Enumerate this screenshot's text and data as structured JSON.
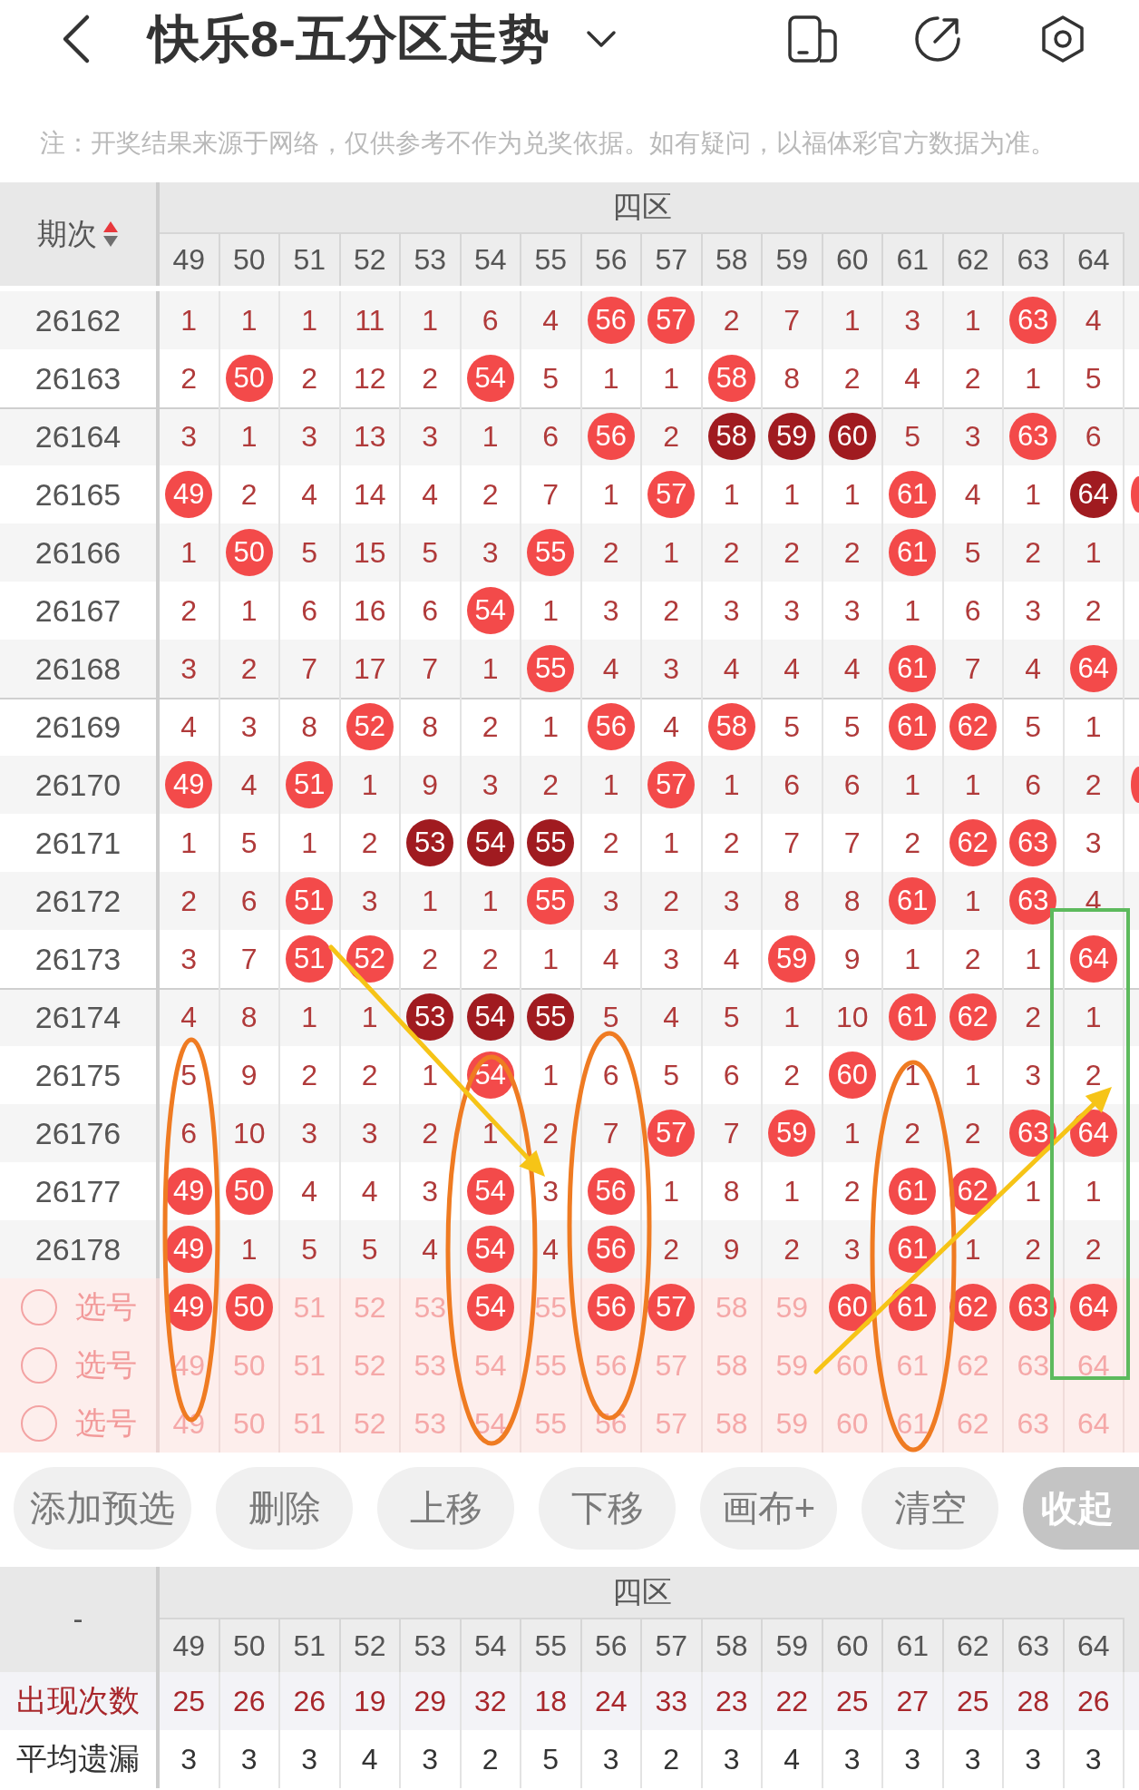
{
  "header": {
    "title": "快乐8-五分区走势"
  },
  "note": "注：开奖结果来源于网络，仅供参考不作为兑奖依据。如有疑问，以福体彩官方数据为准。",
  "trend_table": {
    "period_header": "期次",
    "sort_ascending": true,
    "group": "四区",
    "columns": [
      "49",
      "50",
      "51",
      "52",
      "53",
      "54",
      "55",
      "56",
      "57",
      "58",
      "59",
      "60",
      "61",
      "62",
      "63",
      "64"
    ],
    "rows": [
      {
        "period": "26162",
        "edge_ball": false,
        "cells": [
          {
            "text": "1",
            "kind": "miss"
          },
          {
            "text": "1",
            "kind": "miss"
          },
          {
            "text": "1",
            "kind": "miss"
          },
          {
            "text": "11",
            "kind": "miss"
          },
          {
            "text": "1",
            "kind": "miss"
          },
          {
            "text": "6",
            "kind": "miss"
          },
          {
            "text": "4",
            "kind": "miss"
          },
          {
            "text": "56",
            "kind": "hit"
          },
          {
            "text": "57",
            "kind": "hit"
          },
          {
            "text": "2",
            "kind": "miss"
          },
          {
            "text": "7",
            "kind": "miss"
          },
          {
            "text": "1",
            "kind": "miss"
          },
          {
            "text": "3",
            "kind": "miss"
          },
          {
            "text": "1",
            "kind": "miss"
          },
          {
            "text": "63",
            "kind": "hit"
          },
          {
            "text": "4",
            "kind": "miss"
          }
        ]
      },
      {
        "period": "26163",
        "edge_ball": false,
        "cells": [
          {
            "text": "2",
            "kind": "miss"
          },
          {
            "text": "50",
            "kind": "hit"
          },
          {
            "text": "2",
            "kind": "miss"
          },
          {
            "text": "12",
            "kind": "miss"
          },
          {
            "text": "2",
            "kind": "miss"
          },
          {
            "text": "54",
            "kind": "hit"
          },
          {
            "text": "5",
            "kind": "miss"
          },
          {
            "text": "1",
            "kind": "miss"
          },
          {
            "text": "1",
            "kind": "miss"
          },
          {
            "text": "58",
            "kind": "hit"
          },
          {
            "text": "8",
            "kind": "miss"
          },
          {
            "text": "2",
            "kind": "miss"
          },
          {
            "text": "4",
            "kind": "miss"
          },
          {
            "text": "2",
            "kind": "miss"
          },
          {
            "text": "1",
            "kind": "miss"
          },
          {
            "text": "5",
            "kind": "miss"
          }
        ]
      },
      {
        "period": "26164",
        "edge_ball": false,
        "cells": [
          {
            "text": "3",
            "kind": "miss"
          },
          {
            "text": "1",
            "kind": "miss"
          },
          {
            "text": "3",
            "kind": "miss"
          },
          {
            "text": "13",
            "kind": "miss"
          },
          {
            "text": "3",
            "kind": "miss"
          },
          {
            "text": "1",
            "kind": "miss"
          },
          {
            "text": "6",
            "kind": "miss"
          },
          {
            "text": "56",
            "kind": "hit"
          },
          {
            "text": "2",
            "kind": "miss"
          },
          {
            "text": "58",
            "kind": "streak"
          },
          {
            "text": "59",
            "kind": "streak"
          },
          {
            "text": "60",
            "kind": "streak"
          },
          {
            "text": "5",
            "kind": "miss"
          },
          {
            "text": "3",
            "kind": "miss"
          },
          {
            "text": "63",
            "kind": "hit"
          },
          {
            "text": "6",
            "kind": "miss"
          }
        ]
      },
      {
        "period": "26165",
        "edge_ball": true,
        "cells": [
          {
            "text": "49",
            "kind": "hit"
          },
          {
            "text": "2",
            "kind": "miss"
          },
          {
            "text": "4",
            "kind": "miss"
          },
          {
            "text": "14",
            "kind": "miss"
          },
          {
            "text": "4",
            "kind": "miss"
          },
          {
            "text": "2",
            "kind": "miss"
          },
          {
            "text": "7",
            "kind": "miss"
          },
          {
            "text": "1",
            "kind": "miss"
          },
          {
            "text": "57",
            "kind": "hit"
          },
          {
            "text": "1",
            "kind": "miss"
          },
          {
            "text": "1",
            "kind": "miss"
          },
          {
            "text": "1",
            "kind": "miss"
          },
          {
            "text": "61",
            "kind": "hit"
          },
          {
            "text": "4",
            "kind": "miss"
          },
          {
            "text": "1",
            "kind": "miss"
          },
          {
            "text": "64",
            "kind": "streak"
          }
        ]
      },
      {
        "period": "26166",
        "edge_ball": false,
        "cells": [
          {
            "text": "1",
            "kind": "miss"
          },
          {
            "text": "50",
            "kind": "hit"
          },
          {
            "text": "5",
            "kind": "miss"
          },
          {
            "text": "15",
            "kind": "miss"
          },
          {
            "text": "5",
            "kind": "miss"
          },
          {
            "text": "3",
            "kind": "miss"
          },
          {
            "text": "55",
            "kind": "hit"
          },
          {
            "text": "2",
            "kind": "miss"
          },
          {
            "text": "1",
            "kind": "miss"
          },
          {
            "text": "2",
            "kind": "miss"
          },
          {
            "text": "2",
            "kind": "miss"
          },
          {
            "text": "2",
            "kind": "miss"
          },
          {
            "text": "61",
            "kind": "hit"
          },
          {
            "text": "5",
            "kind": "miss"
          },
          {
            "text": "2",
            "kind": "miss"
          },
          {
            "text": "1",
            "kind": "miss"
          }
        ]
      },
      {
        "period": "26167",
        "edge_ball": false,
        "cells": [
          {
            "text": "2",
            "kind": "miss"
          },
          {
            "text": "1",
            "kind": "miss"
          },
          {
            "text": "6",
            "kind": "miss"
          },
          {
            "text": "16",
            "kind": "miss"
          },
          {
            "text": "6",
            "kind": "miss"
          },
          {
            "text": "54",
            "kind": "hit"
          },
          {
            "text": "1",
            "kind": "miss"
          },
          {
            "text": "3",
            "kind": "miss"
          },
          {
            "text": "2",
            "kind": "miss"
          },
          {
            "text": "3",
            "kind": "miss"
          },
          {
            "text": "3",
            "kind": "miss"
          },
          {
            "text": "3",
            "kind": "miss"
          },
          {
            "text": "1",
            "kind": "miss"
          },
          {
            "text": "6",
            "kind": "miss"
          },
          {
            "text": "3",
            "kind": "miss"
          },
          {
            "text": "2",
            "kind": "miss"
          }
        ]
      },
      {
        "period": "26168",
        "edge_ball": false,
        "cells": [
          {
            "text": "3",
            "kind": "miss"
          },
          {
            "text": "2",
            "kind": "miss"
          },
          {
            "text": "7",
            "kind": "miss"
          },
          {
            "text": "17",
            "kind": "miss"
          },
          {
            "text": "7",
            "kind": "miss"
          },
          {
            "text": "1",
            "kind": "miss"
          },
          {
            "text": "55",
            "kind": "hit"
          },
          {
            "text": "4",
            "kind": "miss"
          },
          {
            "text": "3",
            "kind": "miss"
          },
          {
            "text": "4",
            "kind": "miss"
          },
          {
            "text": "4",
            "kind": "miss"
          },
          {
            "text": "4",
            "kind": "miss"
          },
          {
            "text": "61",
            "kind": "hit"
          },
          {
            "text": "7",
            "kind": "miss"
          },
          {
            "text": "4",
            "kind": "miss"
          },
          {
            "text": "64",
            "kind": "hit"
          }
        ]
      },
      {
        "period": "26169",
        "edge_ball": false,
        "cells": [
          {
            "text": "4",
            "kind": "miss"
          },
          {
            "text": "3",
            "kind": "miss"
          },
          {
            "text": "8",
            "kind": "miss"
          },
          {
            "text": "52",
            "kind": "hit"
          },
          {
            "text": "8",
            "kind": "miss"
          },
          {
            "text": "2",
            "kind": "miss"
          },
          {
            "text": "1",
            "kind": "miss"
          },
          {
            "text": "56",
            "kind": "hit"
          },
          {
            "text": "4",
            "kind": "miss"
          },
          {
            "text": "58",
            "kind": "hit"
          },
          {
            "text": "5",
            "kind": "miss"
          },
          {
            "text": "5",
            "kind": "miss"
          },
          {
            "text": "61",
            "kind": "hit"
          },
          {
            "text": "62",
            "kind": "hit"
          },
          {
            "text": "5",
            "kind": "miss"
          },
          {
            "text": "1",
            "kind": "miss"
          }
        ]
      },
      {
        "period": "26170",
        "edge_ball": true,
        "cells": [
          {
            "text": "49",
            "kind": "hit"
          },
          {
            "text": "4",
            "kind": "miss"
          },
          {
            "text": "51",
            "kind": "hit"
          },
          {
            "text": "1",
            "kind": "miss"
          },
          {
            "text": "9",
            "kind": "miss"
          },
          {
            "text": "3",
            "kind": "miss"
          },
          {
            "text": "2",
            "kind": "miss"
          },
          {
            "text": "1",
            "kind": "miss"
          },
          {
            "text": "57",
            "kind": "hit"
          },
          {
            "text": "1",
            "kind": "miss"
          },
          {
            "text": "6",
            "kind": "miss"
          },
          {
            "text": "6",
            "kind": "miss"
          },
          {
            "text": "1",
            "kind": "miss"
          },
          {
            "text": "1",
            "kind": "miss"
          },
          {
            "text": "6",
            "kind": "miss"
          },
          {
            "text": "2",
            "kind": "miss"
          }
        ]
      },
      {
        "period": "26171",
        "edge_ball": false,
        "cells": [
          {
            "text": "1",
            "kind": "miss"
          },
          {
            "text": "5",
            "kind": "miss"
          },
          {
            "text": "1",
            "kind": "miss"
          },
          {
            "text": "2",
            "kind": "miss"
          },
          {
            "text": "53",
            "kind": "streak"
          },
          {
            "text": "54",
            "kind": "streak"
          },
          {
            "text": "55",
            "kind": "streak"
          },
          {
            "text": "2",
            "kind": "miss"
          },
          {
            "text": "1",
            "kind": "miss"
          },
          {
            "text": "2",
            "kind": "miss"
          },
          {
            "text": "7",
            "kind": "miss"
          },
          {
            "text": "7",
            "kind": "miss"
          },
          {
            "text": "2",
            "kind": "miss"
          },
          {
            "text": "62",
            "kind": "hit"
          },
          {
            "text": "63",
            "kind": "hit"
          },
          {
            "text": "3",
            "kind": "miss"
          }
        ]
      },
      {
        "period": "26172",
        "edge_ball": false,
        "cells": [
          {
            "text": "2",
            "kind": "miss"
          },
          {
            "text": "6",
            "kind": "miss"
          },
          {
            "text": "51",
            "kind": "hit"
          },
          {
            "text": "3",
            "kind": "miss"
          },
          {
            "text": "1",
            "kind": "miss"
          },
          {
            "text": "1",
            "kind": "miss"
          },
          {
            "text": "55",
            "kind": "hit"
          },
          {
            "text": "3",
            "kind": "miss"
          },
          {
            "text": "2",
            "kind": "miss"
          },
          {
            "text": "3",
            "kind": "miss"
          },
          {
            "text": "8",
            "kind": "miss"
          },
          {
            "text": "8",
            "kind": "miss"
          },
          {
            "text": "61",
            "kind": "hit"
          },
          {
            "text": "1",
            "kind": "miss"
          },
          {
            "text": "63",
            "kind": "hit"
          },
          {
            "text": "4",
            "kind": "miss"
          }
        ]
      },
      {
        "period": "26173",
        "edge_ball": false,
        "cells": [
          {
            "text": "3",
            "kind": "miss"
          },
          {
            "text": "7",
            "kind": "miss"
          },
          {
            "text": "51",
            "kind": "hit"
          },
          {
            "text": "52",
            "kind": "hit"
          },
          {
            "text": "2",
            "kind": "miss"
          },
          {
            "text": "2",
            "kind": "miss"
          },
          {
            "text": "1",
            "kind": "miss"
          },
          {
            "text": "4",
            "kind": "miss"
          },
          {
            "text": "3",
            "kind": "miss"
          },
          {
            "text": "4",
            "kind": "miss"
          },
          {
            "text": "59",
            "kind": "hit"
          },
          {
            "text": "9",
            "kind": "miss"
          },
          {
            "text": "1",
            "kind": "miss"
          },
          {
            "text": "2",
            "kind": "miss"
          },
          {
            "text": "1",
            "kind": "miss"
          },
          {
            "text": "64",
            "kind": "hit"
          }
        ]
      },
      {
        "period": "26174",
        "edge_ball": false,
        "cells": [
          {
            "text": "4",
            "kind": "miss"
          },
          {
            "text": "8",
            "kind": "miss"
          },
          {
            "text": "1",
            "kind": "miss"
          },
          {
            "text": "1",
            "kind": "miss"
          },
          {
            "text": "53",
            "kind": "streak"
          },
          {
            "text": "54",
            "kind": "streak"
          },
          {
            "text": "55",
            "kind": "streak"
          },
          {
            "text": "5",
            "kind": "miss"
          },
          {
            "text": "4",
            "kind": "miss"
          },
          {
            "text": "5",
            "kind": "miss"
          },
          {
            "text": "1",
            "kind": "miss"
          },
          {
            "text": "10",
            "kind": "miss"
          },
          {
            "text": "61",
            "kind": "hit"
          },
          {
            "text": "62",
            "kind": "hit"
          },
          {
            "text": "2",
            "kind": "miss"
          },
          {
            "text": "1",
            "kind": "miss"
          }
        ]
      },
      {
        "period": "26175",
        "edge_ball": false,
        "cells": [
          {
            "text": "5",
            "kind": "miss"
          },
          {
            "text": "9",
            "kind": "miss"
          },
          {
            "text": "2",
            "kind": "miss"
          },
          {
            "text": "2",
            "kind": "miss"
          },
          {
            "text": "1",
            "kind": "miss"
          },
          {
            "text": "54",
            "kind": "hit"
          },
          {
            "text": "1",
            "kind": "miss"
          },
          {
            "text": "6",
            "kind": "miss"
          },
          {
            "text": "5",
            "kind": "miss"
          },
          {
            "text": "6",
            "kind": "miss"
          },
          {
            "text": "2",
            "kind": "miss"
          },
          {
            "text": "60",
            "kind": "hit"
          },
          {
            "text": "1",
            "kind": "miss"
          },
          {
            "text": "1",
            "kind": "miss"
          },
          {
            "text": "3",
            "kind": "miss"
          },
          {
            "text": "2",
            "kind": "miss"
          }
        ]
      },
      {
        "period": "26176",
        "edge_ball": false,
        "cells": [
          {
            "text": "6",
            "kind": "miss"
          },
          {
            "text": "10",
            "kind": "miss"
          },
          {
            "text": "3",
            "kind": "miss"
          },
          {
            "text": "3",
            "kind": "miss"
          },
          {
            "text": "2",
            "kind": "miss"
          },
          {
            "text": "1",
            "kind": "miss"
          },
          {
            "text": "2",
            "kind": "miss"
          },
          {
            "text": "7",
            "kind": "miss"
          },
          {
            "text": "57",
            "kind": "hit"
          },
          {
            "text": "7",
            "kind": "miss"
          },
          {
            "text": "59",
            "kind": "hit"
          },
          {
            "text": "1",
            "kind": "miss"
          },
          {
            "text": "2",
            "kind": "miss"
          },
          {
            "text": "2",
            "kind": "miss"
          },
          {
            "text": "63",
            "kind": "hit"
          },
          {
            "text": "64",
            "kind": "hit"
          }
        ]
      },
      {
        "period": "26177",
        "edge_ball": false,
        "cells": [
          {
            "text": "49",
            "kind": "hit"
          },
          {
            "text": "50",
            "kind": "hit"
          },
          {
            "text": "4",
            "kind": "miss"
          },
          {
            "text": "4",
            "kind": "miss"
          },
          {
            "text": "3",
            "kind": "miss"
          },
          {
            "text": "54",
            "kind": "hit"
          },
          {
            "text": "3",
            "kind": "miss"
          },
          {
            "text": "56",
            "kind": "hit"
          },
          {
            "text": "1",
            "kind": "miss"
          },
          {
            "text": "8",
            "kind": "miss"
          },
          {
            "text": "1",
            "kind": "miss"
          },
          {
            "text": "2",
            "kind": "miss"
          },
          {
            "text": "61",
            "kind": "hit"
          },
          {
            "text": "62",
            "kind": "hit"
          },
          {
            "text": "1",
            "kind": "miss"
          },
          {
            "text": "1",
            "kind": "miss"
          }
        ]
      },
      {
        "period": "26178",
        "edge_ball": false,
        "cells": [
          {
            "text": "49",
            "kind": "hit"
          },
          {
            "text": "1",
            "kind": "miss"
          },
          {
            "text": "5",
            "kind": "miss"
          },
          {
            "text": "5",
            "kind": "miss"
          },
          {
            "text": "4",
            "kind": "miss"
          },
          {
            "text": "54",
            "kind": "hit"
          },
          {
            "text": "4",
            "kind": "miss"
          },
          {
            "text": "56",
            "kind": "hit"
          },
          {
            "text": "2",
            "kind": "miss"
          },
          {
            "text": "9",
            "kind": "miss"
          },
          {
            "text": "2",
            "kind": "miss"
          },
          {
            "text": "3",
            "kind": "miss"
          },
          {
            "text": "61",
            "kind": "hit"
          },
          {
            "text": "1",
            "kind": "miss"
          },
          {
            "text": "2",
            "kind": "miss"
          },
          {
            "text": "2",
            "kind": "miss"
          }
        ]
      }
    ],
    "pick_rows": [
      {
        "checked": false,
        "label": "选号",
        "numbers": [
          {
            "text": "49",
            "selected": true
          },
          {
            "text": "50",
            "selected": true
          },
          {
            "text": "51",
            "selected": false
          },
          {
            "text": "52",
            "selected": false
          },
          {
            "text": "53",
            "selected": false
          },
          {
            "text": "54",
            "selected": true
          },
          {
            "text": "55",
            "selected": false
          },
          {
            "text": "56",
            "selected": true
          },
          {
            "text": "57",
            "selected": true
          },
          {
            "text": "58",
            "selected": false
          },
          {
            "text": "59",
            "selected": false
          },
          {
            "text": "60",
            "selected": true
          },
          {
            "text": "61",
            "selected": true
          },
          {
            "text": "62",
            "selected": true
          },
          {
            "text": "63",
            "selected": true
          },
          {
            "text": "64",
            "selected": true
          }
        ]
      },
      {
        "checked": false,
        "label": "选号",
        "numbers": [
          {
            "text": "49",
            "selected": false
          },
          {
            "text": "50",
            "selected": false
          },
          {
            "text": "51",
            "selected": false
          },
          {
            "text": "52",
            "selected": false
          },
          {
            "text": "53",
            "selected": false
          },
          {
            "text": "54",
            "selected": false
          },
          {
            "text": "55",
            "selected": false
          },
          {
            "text": "56",
            "selected": false
          },
          {
            "text": "57",
            "selected": false
          },
          {
            "text": "58",
            "selected": false
          },
          {
            "text": "59",
            "selected": false
          },
          {
            "text": "60",
            "selected": false
          },
          {
            "text": "61",
            "selected": false
          },
          {
            "text": "62",
            "selected": false
          },
          {
            "text": "63",
            "selected": false
          },
          {
            "text": "64",
            "selected": false
          }
        ]
      },
      {
        "checked": false,
        "label": "选号",
        "numbers": [
          {
            "text": "49",
            "selected": false
          },
          {
            "text": "50",
            "selected": false
          },
          {
            "text": "51",
            "selected": false
          },
          {
            "text": "52",
            "selected": false
          },
          {
            "text": "53",
            "selected": false
          },
          {
            "text": "54",
            "selected": false
          },
          {
            "text": "55",
            "selected": false
          },
          {
            "text": "56",
            "selected": false
          },
          {
            "text": "57",
            "selected": false
          },
          {
            "text": "58",
            "selected": false
          },
          {
            "text": "59",
            "selected": false
          },
          {
            "text": "60",
            "selected": false
          },
          {
            "text": "61",
            "selected": false
          },
          {
            "text": "62",
            "selected": false
          },
          {
            "text": "63",
            "selected": false
          },
          {
            "text": "64",
            "selected": false
          }
        ]
      }
    ]
  },
  "buttons": [
    {
      "label": "添加预选",
      "kind": "plain"
    },
    {
      "label": "删除",
      "kind": "plain"
    },
    {
      "label": "上移",
      "kind": "plain"
    },
    {
      "label": "下移",
      "kind": "plain"
    },
    {
      "label": "画布+",
      "kind": "plain"
    },
    {
      "label": "清空",
      "kind": "plain"
    },
    {
      "label": "收起",
      "kind": "dark"
    }
  ],
  "stats_table": {
    "corner": "-",
    "group": "四区",
    "columns": [
      "49",
      "50",
      "51",
      "52",
      "53",
      "54",
      "55",
      "56",
      "57",
      "58",
      "59",
      "60",
      "61",
      "62",
      "63",
      "64"
    ],
    "rows": [
      {
        "label": "出现次数",
        "kind": "count",
        "values": [
          "25",
          "26",
          "26",
          "19",
          "29",
          "32",
          "18",
          "24",
          "33",
          "23",
          "22",
          "25",
          "27",
          "25",
          "28",
          "26"
        ]
      },
      {
        "label": "平均遗漏",
        "kind": "average",
        "values": [
          "3",
          "3",
          "3",
          "4",
          "3",
          "2",
          "5",
          "3",
          "2",
          "3",
          "4",
          "3",
          "3",
          "3",
          "3",
          "3"
        ]
      }
    ]
  },
  "annotations": [
    {
      "kind": "ellipse"
    },
    {
      "kind": "ellipse"
    },
    {
      "kind": "ellipse"
    },
    {
      "kind": "ellipse"
    },
    {
      "kind": "arrow"
    },
    {
      "kind": "arrow"
    },
    {
      "kind": "rectangle"
    }
  ]
}
